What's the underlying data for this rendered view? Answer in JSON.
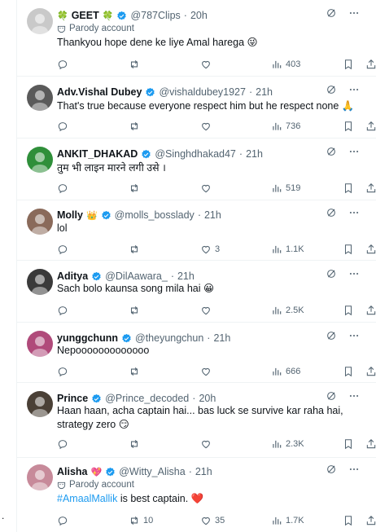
{
  "tweets": [
    {
      "name": "GEET",
      "emoji_pre": "🍀",
      "emoji_post": "🍀",
      "handle": "@787Clips",
      "dot": "·",
      "time": "20h",
      "parody": "Parody account",
      "text": "Thankyou hope dene ke liye Amal  harega 😜",
      "reply": "",
      "retweet": "",
      "like": "",
      "views": "403",
      "avatar_color": "#c9c9c9"
    },
    {
      "name": "Adv.Vishal Dubey",
      "emoji_pre": "",
      "emoji_post": "",
      "handle": "@vishaldubey1927",
      "dot": "·",
      "time": "21h",
      "parody": "",
      "text": "That's true because everyone respect him but he respect none 🙏",
      "reply": "",
      "retweet": "",
      "like": "",
      "views": "736",
      "avatar_color": "#5a5a5a"
    },
    {
      "name": "ANKIT_DHAKAD",
      "emoji_pre": "",
      "emoji_post": "",
      "handle": "@Singhdhakad47",
      "dot": "·",
      "time": "21h",
      "parody": "",
      "text": "तुम भी लाइन मारने लगी उसे ।",
      "reply": "",
      "retweet": "",
      "like": "",
      "views": "519",
      "avatar_color": "#2f8f3a"
    },
    {
      "name": "Molly",
      "emoji_pre": "",
      "emoji_post": "👑",
      "handle": "@molls_bosslady",
      "dot": "·",
      "time": "21h",
      "parody": "",
      "text": "lol",
      "reply": "",
      "retweet": "",
      "like": "3",
      "views": "1.1K",
      "avatar_color": "#8a6a5a"
    },
    {
      "name": "Aditya",
      "emoji_pre": "",
      "emoji_post": "",
      "handle": "@DilAawara_",
      "dot": "·",
      "time": "21h",
      "parody": "",
      "text": "Sach bolo kaunsa song mila hai 😀",
      "reply": "",
      "retweet": "",
      "like": "",
      "views": "2.5K",
      "avatar_color": "#3a3a3a"
    },
    {
      "name": "yunggchunn",
      "emoji_pre": "",
      "emoji_post": "",
      "handle": "@theyungchun",
      "dot": "·",
      "time": "21h",
      "parody": "",
      "text": "Nepooooooooooooo",
      "reply": "",
      "retweet": "",
      "like": "",
      "views": "666",
      "avatar_color": "#b04a7a"
    },
    {
      "name": "Prince",
      "emoji_pre": "",
      "emoji_post": "",
      "handle": "@Prince_decoded",
      "dot": "·",
      "time": "20h",
      "parody": "",
      "text": "Haan haan, acha captain hai... bas luck se survive kar raha hai, strategy zero 😏",
      "reply": "",
      "retweet": "",
      "like": "",
      "views": "2.3K",
      "avatar_color": "#4a4036"
    },
    {
      "name": "Alisha",
      "emoji_pre": "",
      "emoji_post": "💖",
      "handle": "@Witty_Alisha",
      "dot": "·",
      "time": "21h",
      "parody": "Parody account",
      "text_hashtag": "#AmaalMallik",
      "text": " is best captain. ❤️",
      "reply": "",
      "retweet": "10",
      "like": "35",
      "views": "1.7K",
      "avatar_color": "#c78a9a"
    }
  ],
  "stray_mark": ".",
  "colors": {
    "verified": "#1d9bf0",
    "muted": "#536471",
    "text": "#0f1419",
    "link": "#1d9bf0"
  }
}
